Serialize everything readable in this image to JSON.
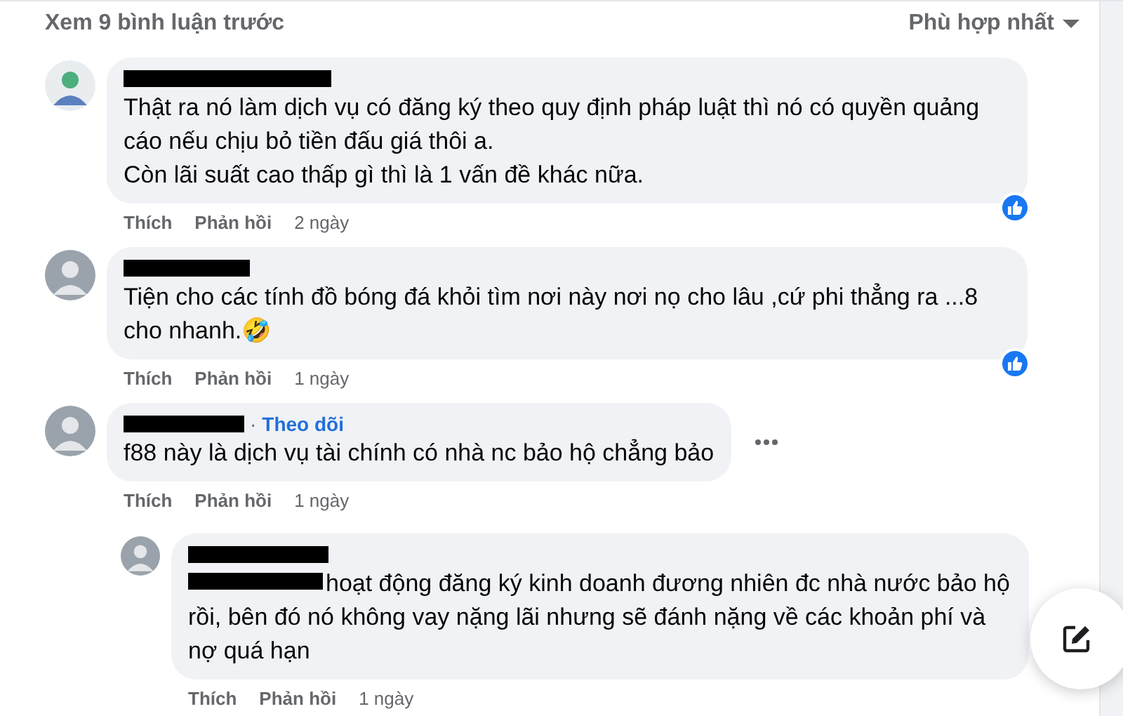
{
  "header": {
    "view_previous": "Xem 9 bình luận trước",
    "sort": "Phù hợp nhất"
  },
  "comments": [
    {
      "name_redacted": true,
      "text": "Thật ra nó làm dịch vụ có đăng ký theo quy định pháp luật thì nó có quyền quảng cáo nếu chịu bỏ tiền đấu giá thôi a.\nCòn lãi suất cao thấp gì thì là 1 vấn đề khác nữa.",
      "liked": true,
      "actions": {
        "like": "Thích",
        "reply": "Phản hồi",
        "time": "2 ngày"
      }
    },
    {
      "name_redacted": true,
      "text": "Tiện cho các tính đồ bóng đá khỏi tìm nơi này nơi nọ cho lâu ,cứ phi thẳng ra ...8 cho nhanh.🤣",
      "liked": true,
      "actions": {
        "like": "Thích",
        "reply": "Phản hồi",
        "time": "1 ngày"
      }
    },
    {
      "name_redacted": true,
      "follow_separator": "·",
      "follow": "Theo dõi",
      "more_menu": true,
      "text": "f88 này là dịch vụ tài chính có nhà nc bảo hộ chẳng bảo",
      "liked": false,
      "actions": {
        "like": "Thích",
        "reply": "Phản hồi",
        "time": "1 ngày"
      },
      "replies": [
        {
          "name_redacted": true,
          "mention_redacted": true,
          "text": "hoạt động đăng ký kinh doanh đương nhiên đc nhà nước bảo hộ rồi, bên đó nó không vay nặng lãi nhưng sẽ đánh nặng về các khoản phí và nợ quá hạn",
          "liked": false,
          "actions": {
            "like": "Thích",
            "reply": "Phản hồi",
            "time": "1 ngày"
          }
        }
      ]
    }
  ],
  "compose_button": true
}
